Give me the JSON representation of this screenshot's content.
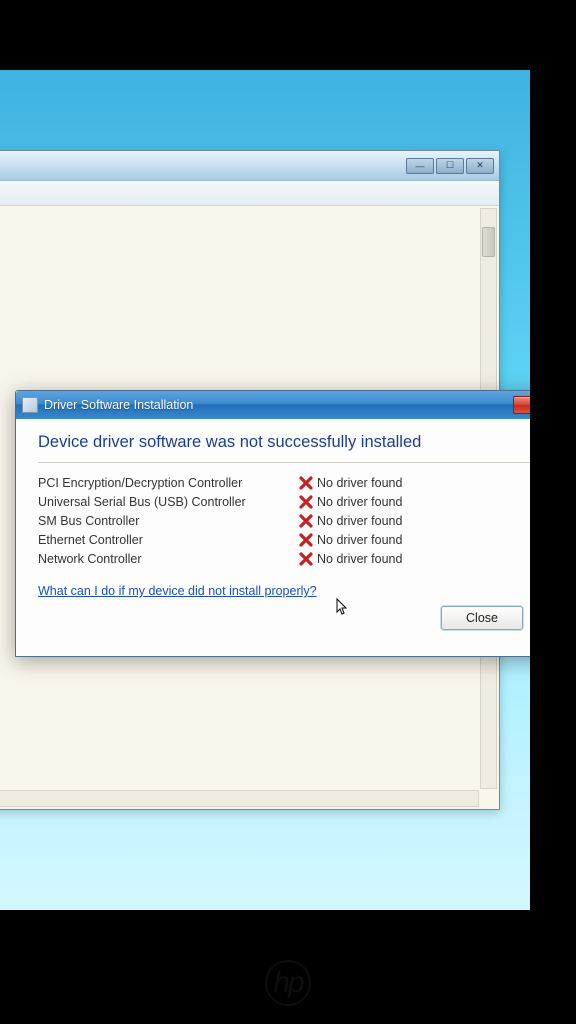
{
  "dialog": {
    "title": "Driver Software Installation",
    "heading": "Device driver software was not successfully installed",
    "devices": [
      {
        "name": "PCI Encryption/Decryption Controller",
        "status": "No driver found"
      },
      {
        "name": "Universal Serial Bus (USB) Controller",
        "status": "No driver found"
      },
      {
        "name": "SM Bus Controller",
        "status": "No driver found"
      },
      {
        "name": "Ethernet Controller",
        "status": "No driver found"
      },
      {
        "name": "Network Controller",
        "status": "No driver found"
      }
    ],
    "help_link": "What can I do if my device did not install properly?",
    "close_button": "Close"
  },
  "icons": {
    "fail_color": "#c62020"
  }
}
